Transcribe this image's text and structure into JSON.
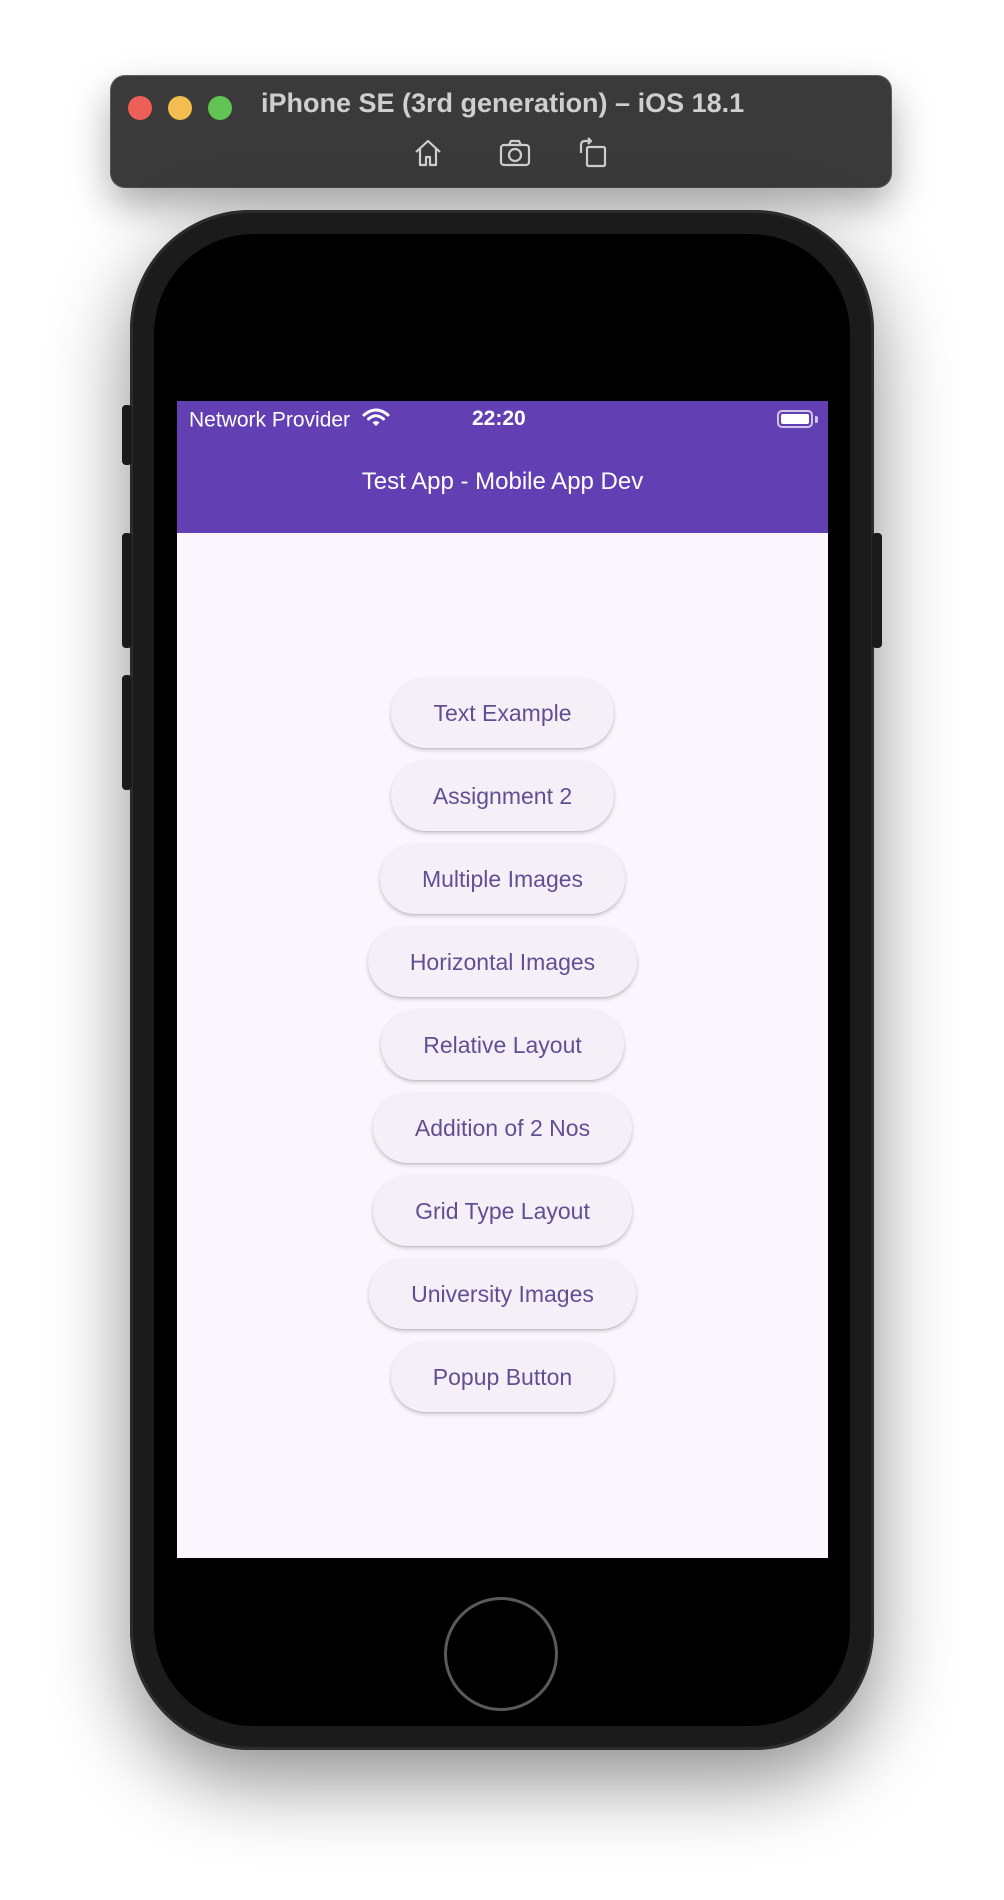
{
  "simulator": {
    "title": "iPhone SE (3rd generation) – iOS 18.1",
    "toolbar_icons": [
      "home-icon",
      "screenshot-icon",
      "rotate-icon"
    ]
  },
  "status_bar": {
    "carrier": "Network Provider",
    "time": "22:20"
  },
  "app_bar": {
    "title": "Test App - Mobile App Dev",
    "color": "#633fb4"
  },
  "buttons": [
    {
      "label": "Text Example"
    },
    {
      "label": "Assignment 2"
    },
    {
      "label": "Multiple Images"
    },
    {
      "label": "Horizontal Images"
    },
    {
      "label": "Relative Layout"
    },
    {
      "label": "Addition of 2 Nos"
    },
    {
      "label": "Grid Type Layout"
    },
    {
      "label": "University Images"
    },
    {
      "label": "Popup Button"
    }
  ],
  "colors": {
    "screen_background": "#fbf6fd",
    "button_background": "#f5f0f8",
    "button_text": "#624f92"
  }
}
